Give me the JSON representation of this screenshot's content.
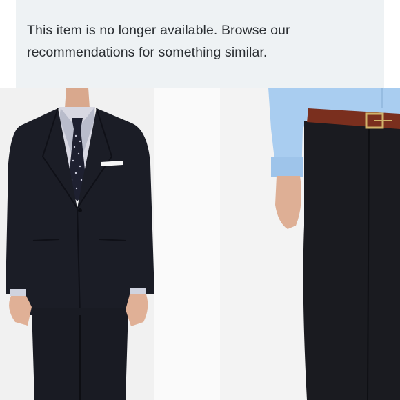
{
  "notice": {
    "message": "This item is no longer available. Browse our recommendations for something similar."
  },
  "gallery": {
    "images": [
      {
        "subject": "navy suit jacket and trousers"
      },
      {
        "subject": "navy trousers with brown belt"
      }
    ]
  },
  "colors": {
    "notice_bg": "#eef2f4",
    "notice_text": "#2b2f33",
    "suit": "#1b1d26",
    "shirt_blue": "#a9cdf0",
    "belt_brown": "#7a2f1e"
  }
}
